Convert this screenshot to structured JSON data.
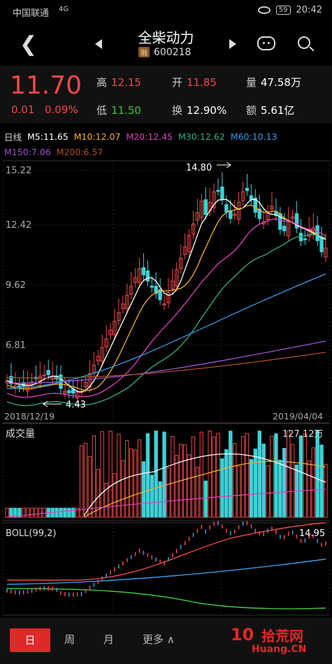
{
  "status": {
    "carrier": "中国联通",
    "signal": "4G",
    "battery": "59",
    "time": "20:42"
  },
  "header": {
    "title": "全柴动力",
    "badge": "融",
    "code": "600218"
  },
  "quote": {
    "price": "11.70",
    "change": "0.01",
    "change_pct": "0.09%",
    "high_label": "高",
    "high": "12.15",
    "open_label": "开",
    "open": "11.85",
    "vol_label": "量",
    "vol": "47.58万",
    "low_label": "低",
    "low": "11.50",
    "turn_label": "换",
    "turn": "12.90%",
    "amt_label": "额",
    "amt": "5.61亿"
  },
  "ma": {
    "period": "日线",
    "m5": "M5:11.65",
    "m10": "M10:12.07",
    "m20": "M20:12.45",
    "m30": "M30:12.62",
    "m60": "M60:10.13",
    "m150": "M150:7.06",
    "m200": "M200:6.57"
  },
  "colors": {
    "m5": "#ffffff",
    "m10": "#f5b030",
    "m20": "#e040c0",
    "m30": "#30b080",
    "m60": "#3a9ae8",
    "m150": "#a050d0",
    "m200": "#b05020",
    "up": "#f04848",
    "down": "#40d0d8"
  },
  "price_axis": [
    "15.22",
    "12.42",
    "9.62",
    "6.81"
  ],
  "annotations": {
    "high_mark": "14.80",
    "low_mark": "4.43",
    "date_start": "2018/12/19",
    "date_end": "2019/04/04"
  },
  "volume": {
    "label": "成交量",
    "max": "127.12万"
  },
  "boll": {
    "label": "BOLL(99,2)",
    "value": "14.95"
  },
  "tabs": {
    "day": "日",
    "week": "周",
    "month": "月",
    "more": "更多"
  },
  "watermark": {
    "num": "10",
    "cn": "拾荒网",
    "en": "Huang.CN"
  }
}
